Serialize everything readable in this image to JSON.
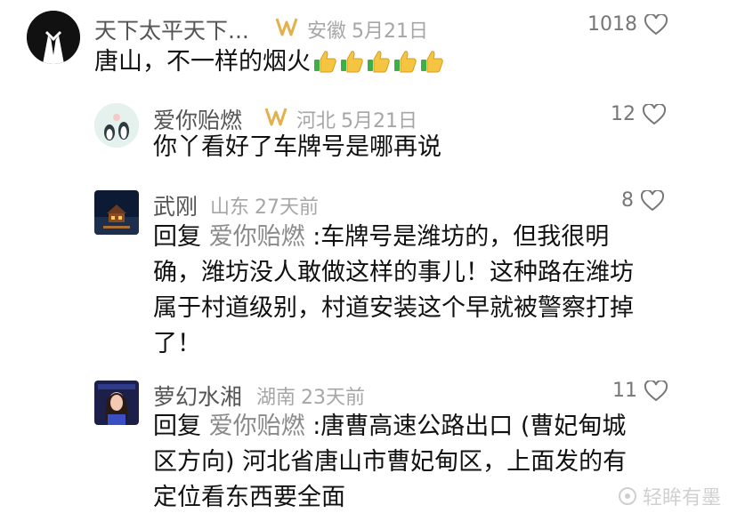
{
  "comments": [
    {
      "username": "天下太平天下...",
      "location": "安徽",
      "date": "5月21日",
      "likes": "1018",
      "text": "唐山，不一样的烟火",
      "emoji_count": 5,
      "emoji_icon": "thumbs-up-icon"
    },
    {
      "username": "爱你贻燃",
      "location": "河北",
      "date": "5月21日",
      "likes": "12",
      "text": "你丫看好了车牌号是哪再说"
    },
    {
      "username": "武刚",
      "location": "山东",
      "date": "27天前",
      "likes": "8",
      "reply_prefix": "回复",
      "reply_to": "爱你贻燃",
      "text_lines": [
        ":车牌号是潍坊的，但我很明",
        "确，潍坊没人敢做这样的事儿！这种路在潍坊",
        "属于村道级别，村道安装这个早就被警察打掉",
        "了！"
      ]
    },
    {
      "username": "萝幻水湘",
      "location": "湖南",
      "date": "23天前",
      "likes": "11",
      "reply_prefix": "回复",
      "reply_to": "爱你贻燃",
      "text_lines": [
        ":唐曹高速公路出口 (曹妃甸城",
        "区方向) 河北省唐山市曹妃甸区，上面发的有",
        "定位看东西要全面"
      ]
    }
  ],
  "watermark": "轻眸有墨",
  "colors": {
    "vip_gold": "#e3b04b",
    "meta_gray": "#a6a6a6"
  }
}
